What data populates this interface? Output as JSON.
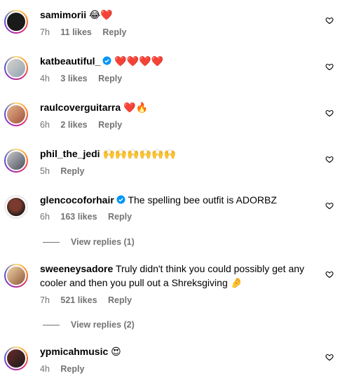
{
  "comments": [
    {
      "username": "samimorii",
      "text": "",
      "emoji": "😂❤️",
      "time": "7h",
      "likes": "11 likes",
      "reply": "Reply",
      "verified": false
    },
    {
      "username": "katbeautiful_",
      "text": "",
      "emoji": "❤️❤️❤️❤️",
      "time": "4h",
      "likes": "3 likes",
      "reply": "Reply",
      "verified": true
    },
    {
      "username": "raulcoverguitarra",
      "text": "",
      "emoji": "❤️🔥",
      "time": "6h",
      "likes": "2 likes",
      "reply": "Reply",
      "verified": false
    },
    {
      "username": "phil_the_jedi",
      "text": "",
      "emoji": "🙌🙌🙌🙌🙌🙌",
      "time": "5h",
      "likes": "",
      "reply": "Reply",
      "verified": false
    },
    {
      "username": "glencocoforhair",
      "text": "The spelling bee outfit is ADORBZ",
      "emoji": "",
      "time": "6h",
      "likes": "163 likes",
      "reply": "Reply",
      "verified": true,
      "view_replies": "View replies (1)"
    },
    {
      "username": "sweeneysadore",
      "text": "Truly didn't think you could possibly get any cooler and then you pull out a Shreksgiving",
      "emoji": "🤌",
      "time": "7h",
      "likes": "521 likes",
      "reply": "Reply",
      "verified": false,
      "view_replies": "View replies (2)"
    },
    {
      "username": "ypmicahmusic",
      "text": "",
      "emoji": "😍",
      "time": "4h",
      "likes": "",
      "reply": "Reply",
      "verified": false
    }
  ],
  "icons": {
    "like": "heart-outline-icon",
    "verified": "verified-badge-icon"
  },
  "colors": {
    "meta": "#737373",
    "verified": "#0095f6"
  }
}
